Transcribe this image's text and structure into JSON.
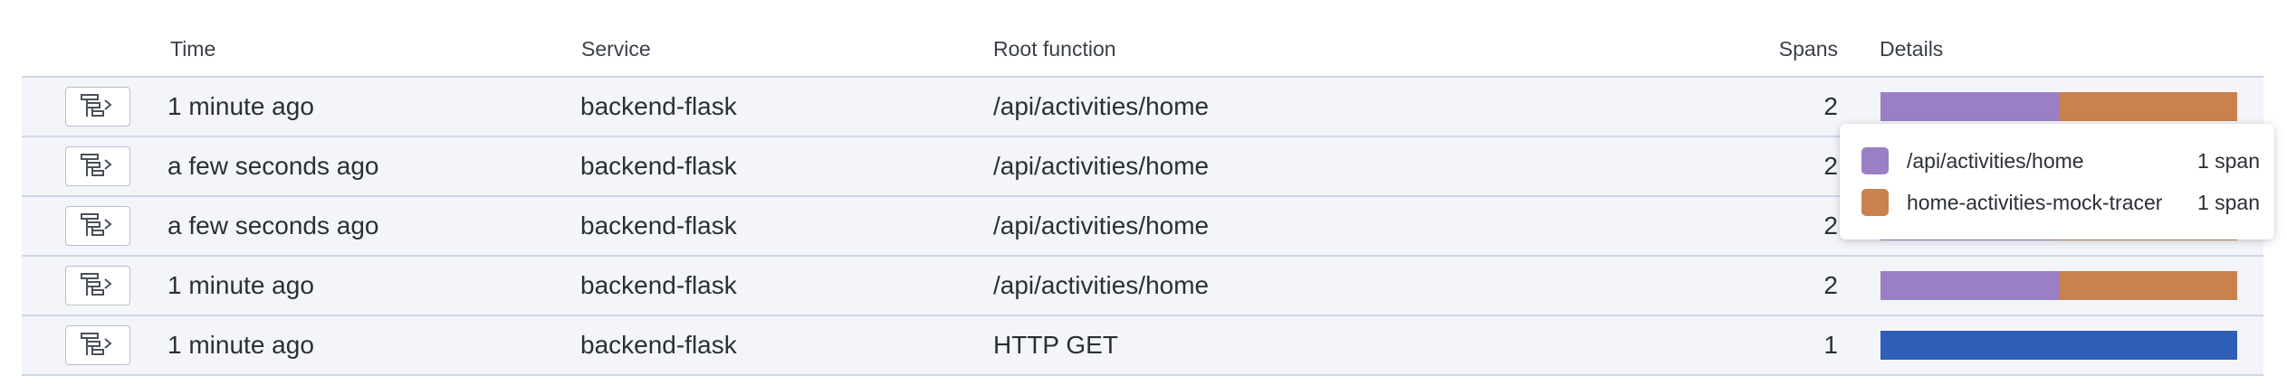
{
  "columns": {
    "time": "Time",
    "service": "Service",
    "root": "Root function",
    "spans": "Spans",
    "details": "Details"
  },
  "rows": [
    {
      "time": "1 minute ago",
      "service": "backend-flask",
      "root": "/api/activities/home",
      "spans": "2",
      "segments": [
        {
          "color": "#9b7fc6",
          "fraction": 0.5
        },
        {
          "color": "#c9824e",
          "fraction": 0.5
        }
      ]
    },
    {
      "time": "a few seconds ago",
      "service": "backend-flask",
      "root": "/api/activities/home",
      "spans": "2",
      "segments": [
        {
          "color": "#9b7fc6",
          "fraction": 0.5
        },
        {
          "color": "#c9824e",
          "fraction": 0.5
        }
      ]
    },
    {
      "time": "a few seconds ago",
      "service": "backend-flask",
      "root": "/api/activities/home",
      "spans": "2",
      "segments": [
        {
          "color": "#9b7fc6",
          "fraction": 0.5
        },
        {
          "color": "#c9824e",
          "fraction": 0.5
        }
      ]
    },
    {
      "time": "1 minute ago",
      "service": "backend-flask",
      "root": "/api/activities/home",
      "spans": "2",
      "segments": [
        {
          "color": "#9b7fc6",
          "fraction": 0.5
        },
        {
          "color": "#c9824e",
          "fraction": 0.5
        }
      ]
    },
    {
      "time": "1 minute ago",
      "service": "backend-flask",
      "root": "HTTP GET",
      "spans": "1",
      "segments": [
        {
          "color": "#2e5eb8",
          "fraction": 1.0
        }
      ]
    }
  ],
  "tooltip": {
    "items": [
      {
        "name": "/api/activities/home",
        "count": "1 span",
        "color": "#9b7fc6"
      },
      {
        "name": "home-activities-mock-tracer",
        "count": "1 span",
        "color": "#c9824e"
      }
    ]
  },
  "icons": {
    "row_button": "trace-view-icon"
  }
}
